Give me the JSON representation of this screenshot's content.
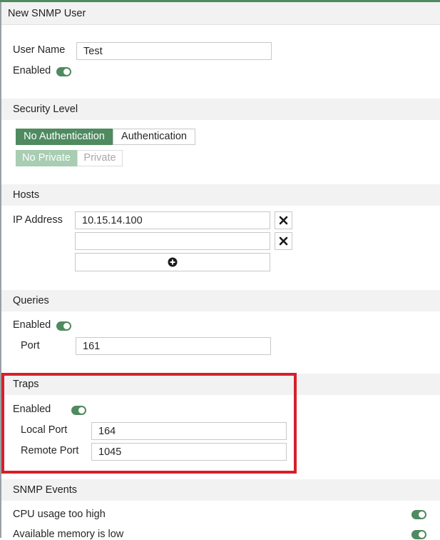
{
  "dialog": {
    "title": "New SNMP User"
  },
  "user": {
    "name_label": "User Name",
    "name_value": "Test",
    "enabled_label": "Enabled",
    "enabled": true
  },
  "security": {
    "header": "Security Level",
    "auth_options": [
      "No Authentication",
      "Authentication"
    ],
    "auth_selected": "No Authentication",
    "priv_options": [
      "No Private",
      "Private"
    ],
    "priv_selected": "No Private"
  },
  "hosts": {
    "header": "Hosts",
    "ip_label": "IP Address",
    "entries": [
      "10.15.14.100",
      ""
    ]
  },
  "queries": {
    "header": "Queries",
    "enabled_label": "Enabled",
    "enabled": true,
    "port_label": "Port",
    "port_value": "161"
  },
  "traps": {
    "header": "Traps",
    "enabled_label": "Enabled",
    "enabled": true,
    "local_port_label": "Local Port",
    "local_port_value": "164",
    "remote_port_label": "Remote Port",
    "remote_port_value": "1045"
  },
  "snmp_events": {
    "header": "SNMP Events",
    "items": [
      {
        "label": "CPU usage too high",
        "enabled": true
      },
      {
        "label": "Available memory is low",
        "enabled": true
      }
    ]
  },
  "colors": {
    "accent": "#4f8a60",
    "accent_disabled": "#a8cdb2",
    "highlight_border": "#d6202b",
    "section_bg": "#f2f2f2"
  }
}
